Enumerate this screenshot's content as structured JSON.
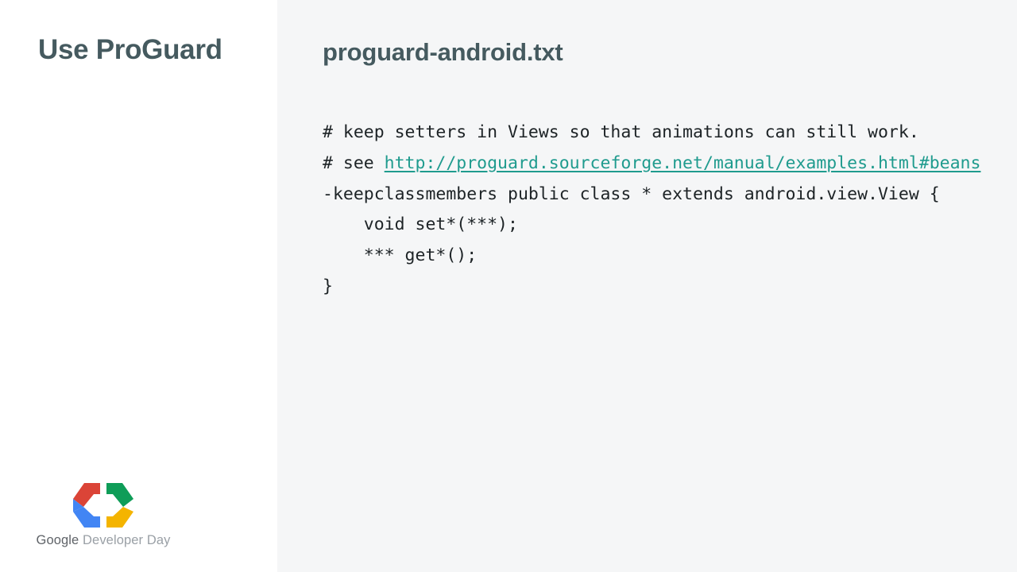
{
  "slide": {
    "title": "Use ProGuard",
    "background_left": "#ffffff",
    "background_right": "#f5f6f7",
    "title_color": "#455a5f",
    "link_color": "#1f9b8e",
    "code_color": "#1d2326"
  },
  "content": {
    "heading": "proguard-android.txt",
    "code_lines": [
      "# keep setters in Views so that animations can still work.",
      "# see "
    ],
    "link_text": "http://proguard.sourceforge.net/manual/examples.html#beans",
    "code_lines_after": [
      "-keepclassmembers public class * extends android.view.View {",
      "    void set*(***);",
      "    *** get*();",
      "}"
    ]
  },
  "logo": {
    "name": "google-developer-day-logo",
    "word_primary": "Google",
    "word_secondary": " Developer Day",
    "colors": {
      "red": "#db4437",
      "blue": "#4285f4",
      "green": "#0f9d58",
      "yellow": "#f4b400",
      "word_primary_color": "#5f6368",
      "word_secondary_color": "#9aa0a6"
    }
  }
}
